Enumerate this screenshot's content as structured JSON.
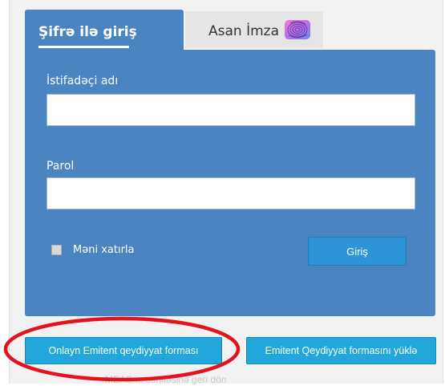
{
  "tabs": {
    "active_label": "Şifrə ilə giriş",
    "inactive_label": "Asan İmza"
  },
  "form": {
    "username_label": "İstifadəçi adı",
    "username_value": "",
    "password_label": "Parol",
    "password_value": "",
    "remember_label": "Məni xatırla",
    "remember_checked": false,
    "login_button": "Giriş"
  },
  "actions": {
    "online_registration": "Onlayn Emitent qeydiyyat forması",
    "download_registration": "Emitent Qeydiyyat formasını yüklə"
  },
  "footer": {
    "back_link": "MEAS ... səhifəsinə geri dön"
  },
  "colors": {
    "panel_blue": "#4a85c2",
    "button_blue": "#2d95d6",
    "action_button": "#21a7d9",
    "highlight_red": "#e3131b"
  },
  "icons": {
    "asan_imza": "fingerprint-icon"
  }
}
